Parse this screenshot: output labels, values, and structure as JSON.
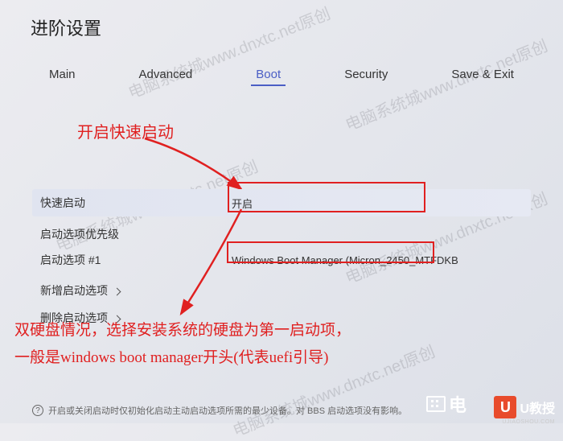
{
  "title": "进阶设置",
  "tabs": {
    "main": "Main",
    "advanced": "Advanced",
    "boot": "Boot",
    "security": "Security",
    "save_exit": "Save & Exit"
  },
  "rows": {
    "fast_boot": {
      "label": "快速启动",
      "value": "开启"
    },
    "priority": {
      "label": "启动选项优先级"
    },
    "option1": {
      "label": "启动选项 #1",
      "value": "Windows Boot Manager (Micron_2450_MTFDKB"
    },
    "add": {
      "label": "新增启动选项"
    },
    "del": {
      "label": "删除启动选项"
    }
  },
  "annotations": {
    "a1": "开启快速启动",
    "a2_line1": "双硬盘情况，选择安装系统的硬盘为第一启动项，",
    "a2_line2": "一般是windows boot manager开头(代表uefi引导)"
  },
  "footer": "开启或关闭启动时仅初始化启动主动启动选项所需的最少设备。对 BBS 启动选项没有影响。",
  "watermark": "电脑系统城www.dnxtc.net原创",
  "logos": {
    "dian": "电",
    "u": "U",
    "ujs": "U教授",
    "ujs_sub": "UJIAOSHOU.COM"
  }
}
